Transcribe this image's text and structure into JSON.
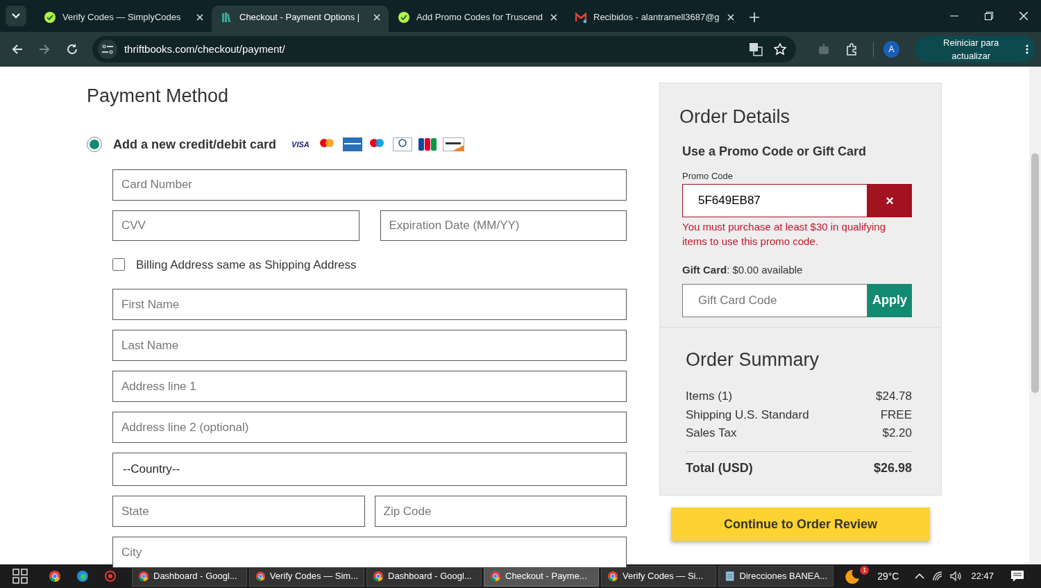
{
  "browser": {
    "tabs": [
      {
        "title": "Verify Codes — SimplyCodes",
        "kind": "simplycodes",
        "selected": false
      },
      {
        "title": "Checkout - Payment Options |",
        "kind": "books",
        "selected": true
      },
      {
        "title": "Add Promo Codes for Truscend",
        "kind": "simplycodes",
        "selected": false
      },
      {
        "title": "Recibidos - alantramell3687@g",
        "kind": "mail",
        "selected": false
      }
    ],
    "url": "thriftbooks.com/checkout/payment/",
    "profile_initial": "A",
    "update_button": "Reiniciar para actualizar"
  },
  "payment": {
    "title": "Payment Method",
    "card_option": {
      "label": "Add a new credit/debit card",
      "selected": true
    },
    "card_logos": [
      {
        "kind": "visa",
        "text": "VISA"
      },
      {
        "kind": "mastercard"
      },
      {
        "kind": "amex"
      },
      {
        "kind": "maestro"
      },
      {
        "kind": "diners"
      },
      {
        "kind": "jcb"
      },
      {
        "kind": "discover"
      }
    ],
    "rows": [
      [
        {
          "kind": "input",
          "placeholder": "Card Number"
        }
      ],
      [
        {
          "kind": "input",
          "placeholder": "CVV"
        },
        {
          "kind": "input",
          "placeholder": "Expiration Date (MM/YY)"
        }
      ],
      [
        {
          "kind": "checkbox",
          "label": "Billing Address same as Shipping Address",
          "checked": false
        }
      ],
      [
        {
          "kind": "input",
          "placeholder": "First Name"
        }
      ],
      [
        {
          "kind": "input",
          "placeholder": "Last Name"
        }
      ],
      [
        {
          "kind": "input",
          "placeholder": "Address line 1"
        }
      ],
      [
        {
          "kind": "input",
          "placeholder": "Address line 2 (optional)"
        }
      ],
      [
        {
          "kind": "select",
          "value": "--Country--"
        }
      ],
      [
        {
          "kind": "input",
          "placeholder": "State"
        },
        {
          "kind": "input",
          "placeholder": "Zip Code"
        }
      ],
      [
        {
          "kind": "input",
          "placeholder": "City"
        }
      ]
    ]
  },
  "order_details": {
    "title": "Order Details",
    "promo_heading": "Use a Promo Code or Gift Card",
    "promo_label": "Promo Code",
    "promo_value": "5F649EB87",
    "remove_button": "×",
    "promo_error": "You must purchase at least $30 in qualifying items to use this promo code.",
    "gift_card_balance": "**Gift Card**: $0.00 available",
    "gift_card_placeholder": "Gift Card Code",
    "apply_button": "Apply"
  },
  "order_summary": {
    "title": "Order Summary",
    "lines": [
      {
        "label": "Items (1)",
        "amount": "$24.78"
      },
      {
        "label": "Shipping U.S. Standard",
        "amount": "FREE"
      },
      {
        "label": "Sales Tax",
        "amount": "$2.20"
      }
    ],
    "total_label": "Total (USD)",
    "total_amount": "$26.98"
  },
  "continue_button": "Continue to Order Review",
  "taskbar": {
    "apps": [
      {
        "title": "Dashboard - Googl...",
        "selected": false
      },
      {
        "title": "Verify Codes — Sim...",
        "selected": false
      },
      {
        "title": "Dashboard - Googl...",
        "selected": false
      },
      {
        "title": "Checkout - Payme...",
        "selected": true
      },
      {
        "title": "Verify Codes — Si...",
        "selected": false
      },
      {
        "title": "Direcciones BANEA...",
        "selected": false,
        "kind": "notepad"
      }
    ],
    "weather_badge": "1",
    "temperature": "29°C",
    "time": "22:47"
  }
}
